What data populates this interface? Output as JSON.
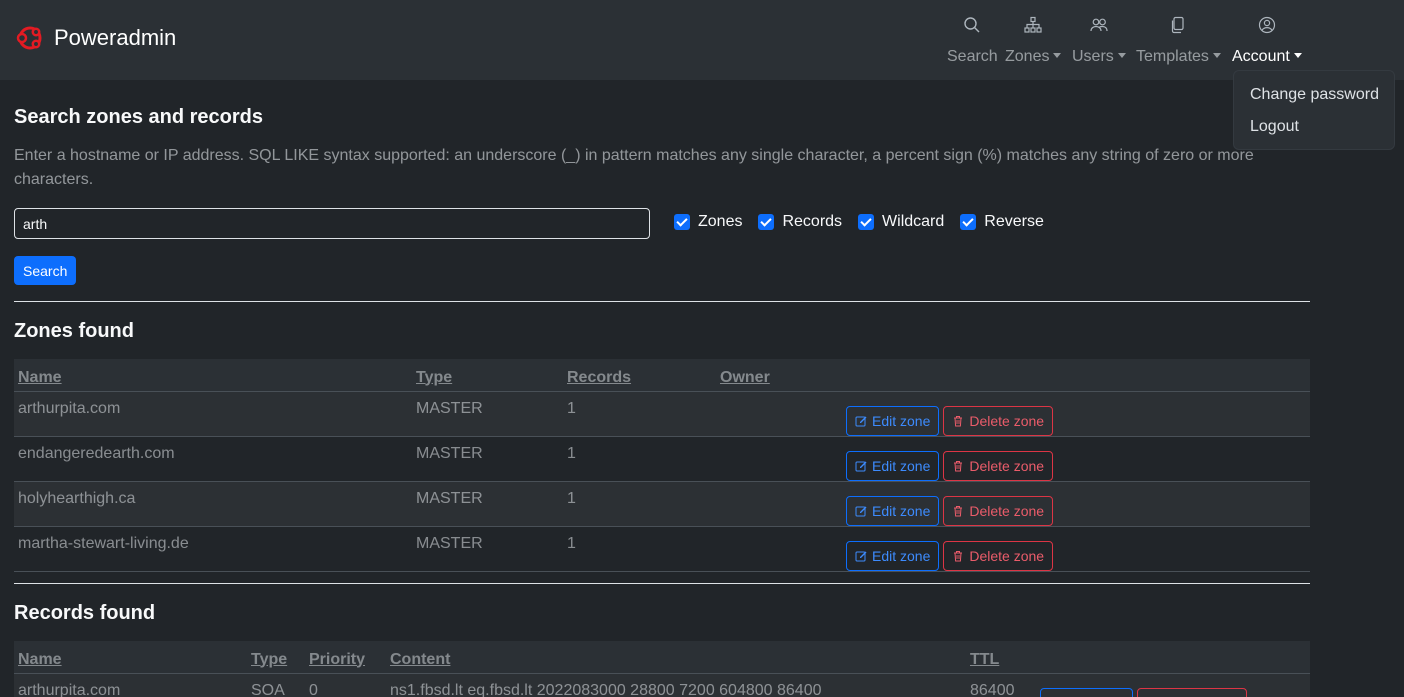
{
  "brand": {
    "name": "Poweradmin",
    "color": "#e31b23"
  },
  "nav": {
    "search": "Search",
    "zones": "Zones",
    "users": "Users",
    "templates": "Templates",
    "account": "Account"
  },
  "account_menu": {
    "change_password": "Change password",
    "logout": "Logout"
  },
  "search": {
    "title": "Search zones and records",
    "help": "Enter a hostname or IP address. SQL LIKE syntax supported: an underscore (_) in pattern matches any single character, a percent sign (%) matches any string of zero or more characters.",
    "query": "arth",
    "filters": {
      "zones": "Zones",
      "records": "Records",
      "wildcard": "Wildcard",
      "reverse": "Reverse"
    },
    "button": "Search"
  },
  "zones": {
    "title": "Zones found",
    "headers": {
      "name": "Name",
      "type": "Type",
      "records": "Records",
      "owner": "Owner"
    },
    "rows": [
      {
        "name": "arthurpita.com",
        "type": "MASTER",
        "records": "1",
        "owner": ""
      },
      {
        "name": "endangeredearth.com",
        "type": "MASTER",
        "records": "1",
        "owner": ""
      },
      {
        "name": "holyhearthigh.ca",
        "type": "MASTER",
        "records": "1",
        "owner": ""
      },
      {
        "name": "martha-stewart-living.de",
        "type": "MASTER",
        "records": "1",
        "owner": ""
      }
    ],
    "edit_label": "Edit zone",
    "delete_label": "Delete zone"
  },
  "records": {
    "title": "Records found",
    "headers": {
      "name": "Name",
      "type": "Type",
      "priority": "Priority",
      "content": "Content",
      "ttl": "TTL"
    },
    "rows": [
      {
        "name": "arthurpita.com",
        "type": "SOA",
        "priority": "0",
        "content": "ns1.fbsd.lt eq.fbsd.lt 2022083000 28800 7200 604800 86400",
        "ttl": "86400"
      }
    ],
    "edit_label": "Edit zone",
    "delete_label": "Delete zone"
  }
}
